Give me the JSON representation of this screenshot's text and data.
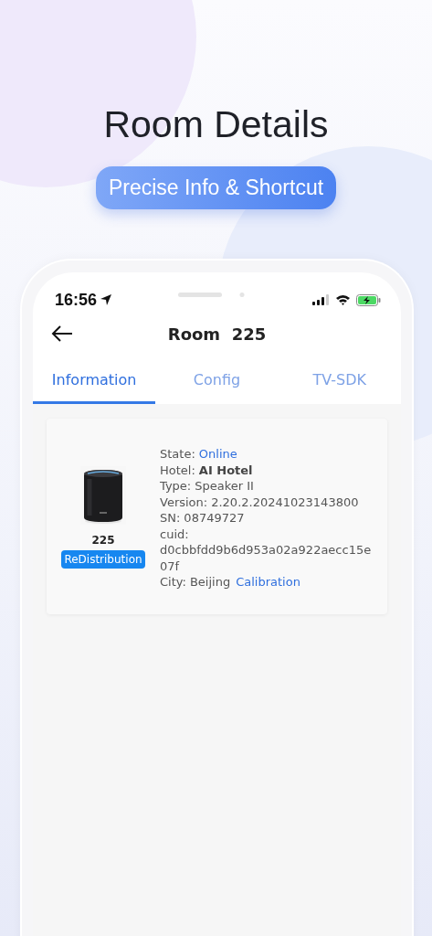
{
  "headline": "Room Details",
  "subtitle": "Precise Info & Shortcut",
  "status_bar": {
    "time": "16:56"
  },
  "header": {
    "title": "Room  225"
  },
  "tabs": [
    {
      "label": "Information",
      "selected": true
    },
    {
      "label": "Config",
      "selected": false
    },
    {
      "label": "TV-SDK",
      "selected": false
    }
  ],
  "device": {
    "room": "225",
    "button": "ReDistribution",
    "fields": [
      {
        "label": "State:",
        "value": "Online",
        "kind": "link"
      },
      {
        "label": "Hotel:",
        "value": "AI Hotel",
        "kind": "bold"
      },
      {
        "label": "Type:",
        "value": "Speaker II",
        "kind": "plain"
      },
      {
        "label": "Version:",
        "value": "2.20.2.20241023143800",
        "kind": "plain"
      },
      {
        "label": "SN:",
        "value": "08749727",
        "kind": "plain"
      },
      {
        "label": "cuid:",
        "value": "d0cbbfdd9b6d953a02a922aecc15e07f",
        "kind": "block"
      },
      {
        "label": "City:",
        "value": "Beijing",
        "kind": "plain",
        "action": "Calibration"
      }
    ]
  }
}
